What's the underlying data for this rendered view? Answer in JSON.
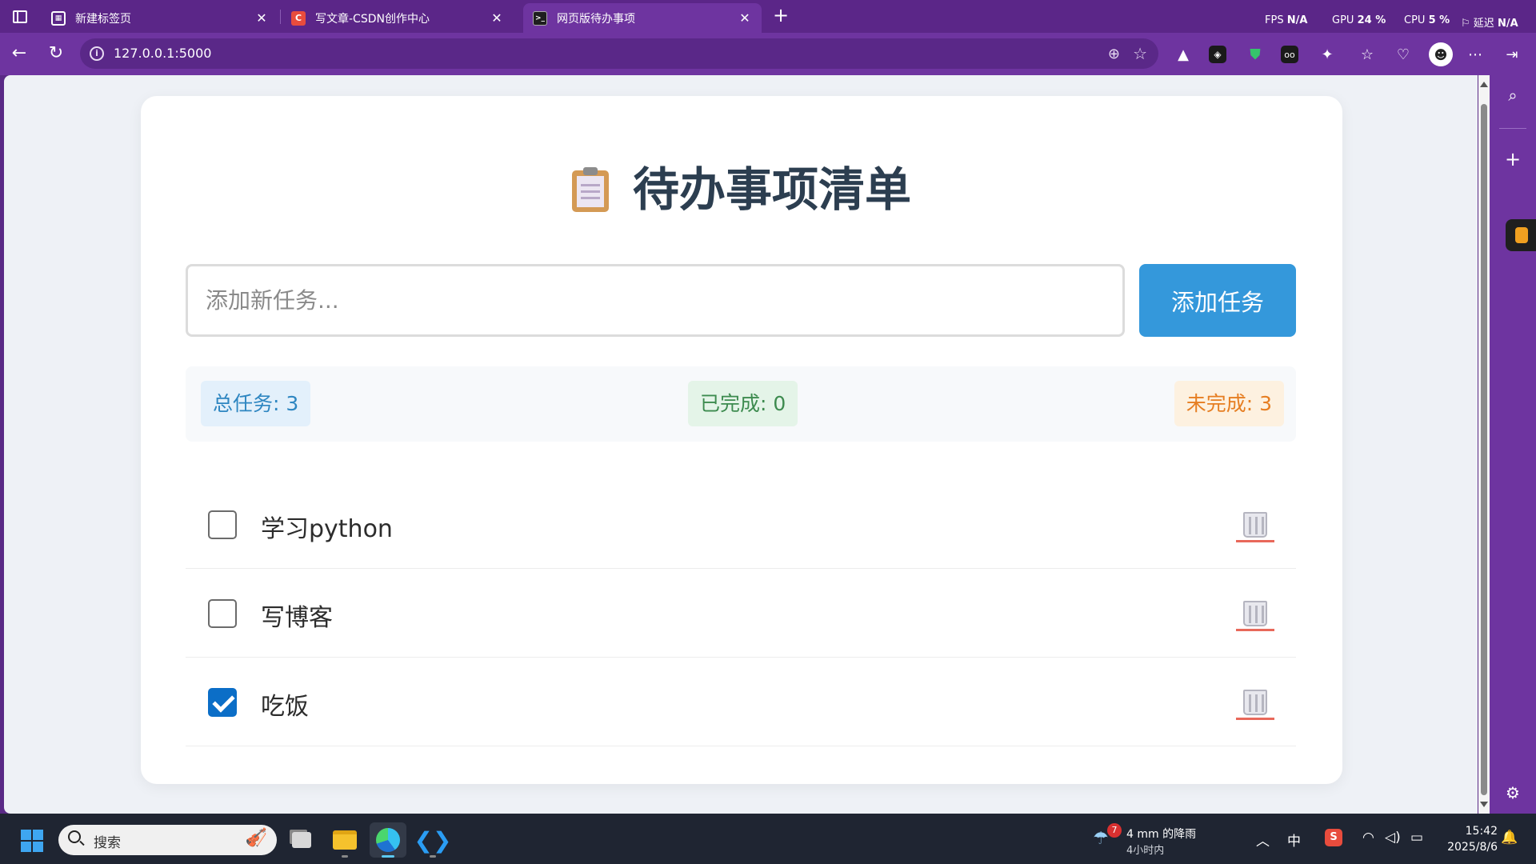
{
  "browser": {
    "tabs": [
      {
        "label": "新建标签页",
        "active": false
      },
      {
        "label": "写文章-CSDN创作中心",
        "active": false
      },
      {
        "label": "网页版待办事项",
        "active": true
      }
    ],
    "new_tab": "+",
    "perf": {
      "fps_label": "FPS",
      "fps_value": "N/A",
      "gpu_label": "GPU",
      "gpu_value": "24 %",
      "cpu_label": "CPU",
      "cpu_value": "5 %",
      "latency_label": "延迟",
      "latency_value": "N/A"
    },
    "url": "127.0.0.1:5000"
  },
  "page": {
    "title": "待办事项清单",
    "input_placeholder": "添加新任务...",
    "add_button": "添加任务",
    "stats": {
      "total": "总任务: 3",
      "completed": "已完成: 0",
      "pending": "未完成: 3"
    },
    "todos": [
      {
        "text": "学习python",
        "checked": false
      },
      {
        "text": "写博客",
        "checked": false
      },
      {
        "text": "吃饭",
        "checked": true
      }
    ]
  },
  "taskbar": {
    "search_label": "搜索",
    "weather_badge": "7",
    "weather_line1": "4 mm 的降雨",
    "weather_line2": "4小时内",
    "ime": "中",
    "time": "15:42",
    "date": "2025/8/6"
  },
  "colors": {
    "accent": "#3498db",
    "frame": "#6e34a0",
    "title": "#2c3e50",
    "total": "#2e86c1",
    "completed": "#3d8b4f",
    "pending": "#e67e22"
  }
}
